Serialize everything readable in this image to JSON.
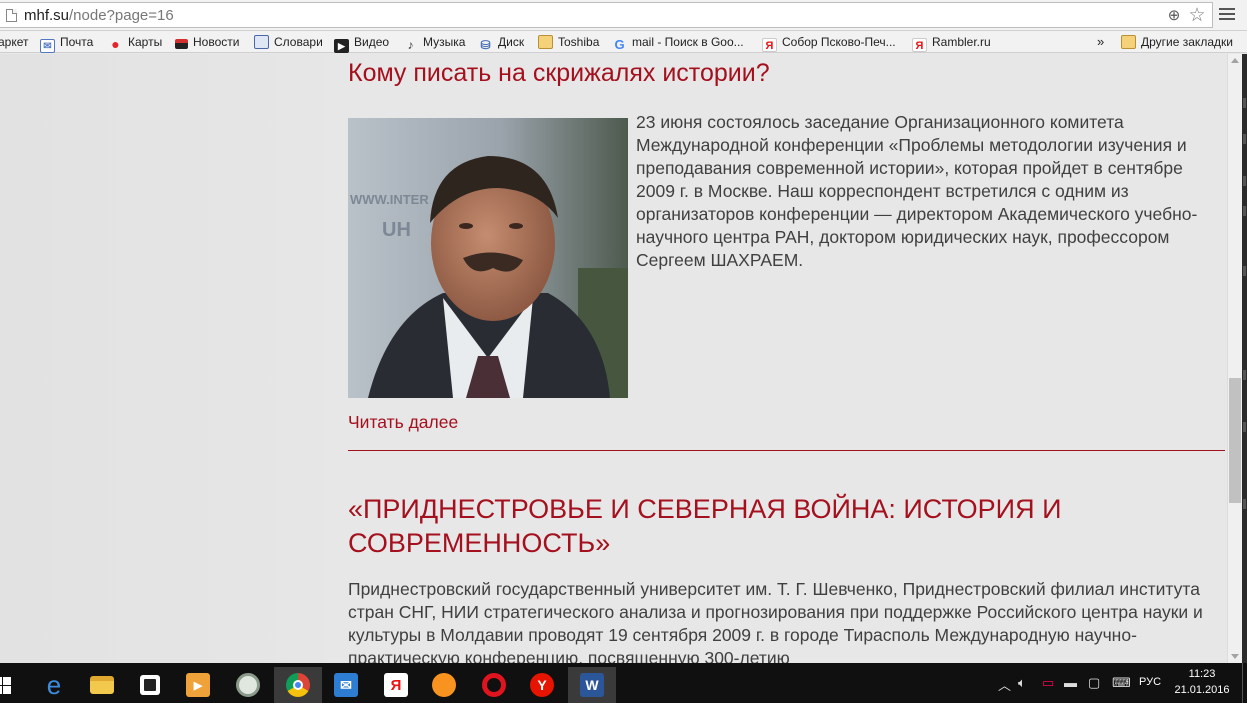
{
  "browser": {
    "url_host": "mhf.su",
    "url_path": "/node?page=16"
  },
  "bookmarks": [
    {
      "label": "аркет",
      "icon": "market-icon"
    },
    {
      "label": "Почта",
      "icon": "mail-icon"
    },
    {
      "label": "Карты",
      "icon": "maps-pin-icon"
    },
    {
      "label": "Новости",
      "icon": "news-icon"
    },
    {
      "label": "Словари",
      "icon": "dictionary-icon"
    },
    {
      "label": "Видео",
      "icon": "video-icon"
    },
    {
      "label": "Музыка",
      "icon": "music-icon"
    },
    {
      "label": "Диск",
      "icon": "disk-icon"
    },
    {
      "label": "Toshiba",
      "icon": "folder-icon"
    },
    {
      "label": "mail - Поиск в Goo...",
      "icon": "google-icon"
    },
    {
      "label": "Собор Псково-Печ...",
      "icon": "yandex-icon"
    },
    {
      "label": "Rambler.ru",
      "icon": "yandex-icon"
    }
  ],
  "bookmarks_overflow": "»",
  "other_bookmarks": "Другие закладки",
  "articles": [
    {
      "title": "Кому писать на скрижалях истории?",
      "text": "23 июня состоялось заседание Организационного комитета Международной конференции «Проблемы методологии изучения и преподавания современной истории», которая пройдет в сентябре 2009 г. в Москве. Наш корреспондент встретился с одним из организаторов конференции — директором Академического учебно-научного центра РАН, доктором юридических наук, профессором Сергеем ШАХРАЕМ.",
      "read_more": "Читать далее"
    },
    {
      "title": "«ПРИДНЕСТРОВЬЕ И СЕВЕРНАЯ ВОЙНА: ИСТОРИЯ И СОВРЕМЕННОСТЬ»",
      "text": "Приднестровский государственный университет им. Т. Г. Шевченко, Приднестровский филиал института стран СНГ, НИИ стратегического анализа и прогнозирования при поддержке Российского центра науки и культуры в Молдавии проводят 19 сентября 2009 г. в городе Тирасполь Международную научно-практическую конференцию, посвященную 300-летию"
    }
  ],
  "taskbar": {
    "apps": [
      {
        "name": "start-icon"
      },
      {
        "name": "edge-icon"
      },
      {
        "name": "file-explorer-icon"
      },
      {
        "name": "store-icon"
      },
      {
        "name": "media-player-icon"
      },
      {
        "name": "generic-app-icon"
      },
      {
        "name": "chrome-icon"
      },
      {
        "name": "mail-app-icon"
      },
      {
        "name": "yandex-browser-icon"
      },
      {
        "name": "orange-app-icon"
      },
      {
        "name": "opera-icon"
      },
      {
        "name": "yandex-icon"
      },
      {
        "name": "word-icon"
      }
    ],
    "language": "РУС",
    "time": "11:23",
    "date": "21.01.2016"
  },
  "colors": {
    "accent": "#a5101e",
    "body_text": "#404040",
    "page_bg": "#e7e7e7"
  }
}
